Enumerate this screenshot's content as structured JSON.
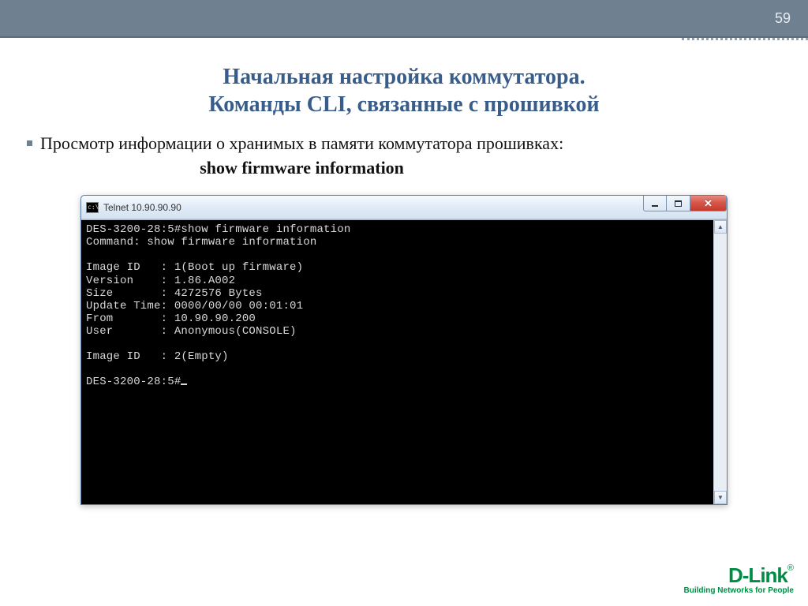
{
  "header": {
    "page_number": "59"
  },
  "title": {
    "line1": "Начальная настройка коммутатора.",
    "line2": "Команды CLI, связанные с прошивкой"
  },
  "bullet": {
    "text": "Просмотр информации о хранимых в памяти коммутатора прошивках:",
    "command": "show firmware information"
  },
  "window": {
    "icon_text": "c:\\",
    "title": "Telnet 10.90.90.90",
    "terminal_lines": [
      "DES-3200-28:5#show firmware information",
      "Command: show firmware information",
      "",
      "Image ID   : 1(Boot up firmware)",
      "Version    : 1.86.A002",
      "Size       : 4272576 Bytes",
      "Update Time: 0000/00/00 00:01:01",
      "From       : 10.90.90.200",
      "User       : Anonymous(CONSOLE)",
      "",
      "Image ID   : 2(Empty)",
      "",
      "DES-3200-28:5#"
    ]
  },
  "logo": {
    "brand": "D-Link",
    "tagline": "Building Networks for People"
  }
}
